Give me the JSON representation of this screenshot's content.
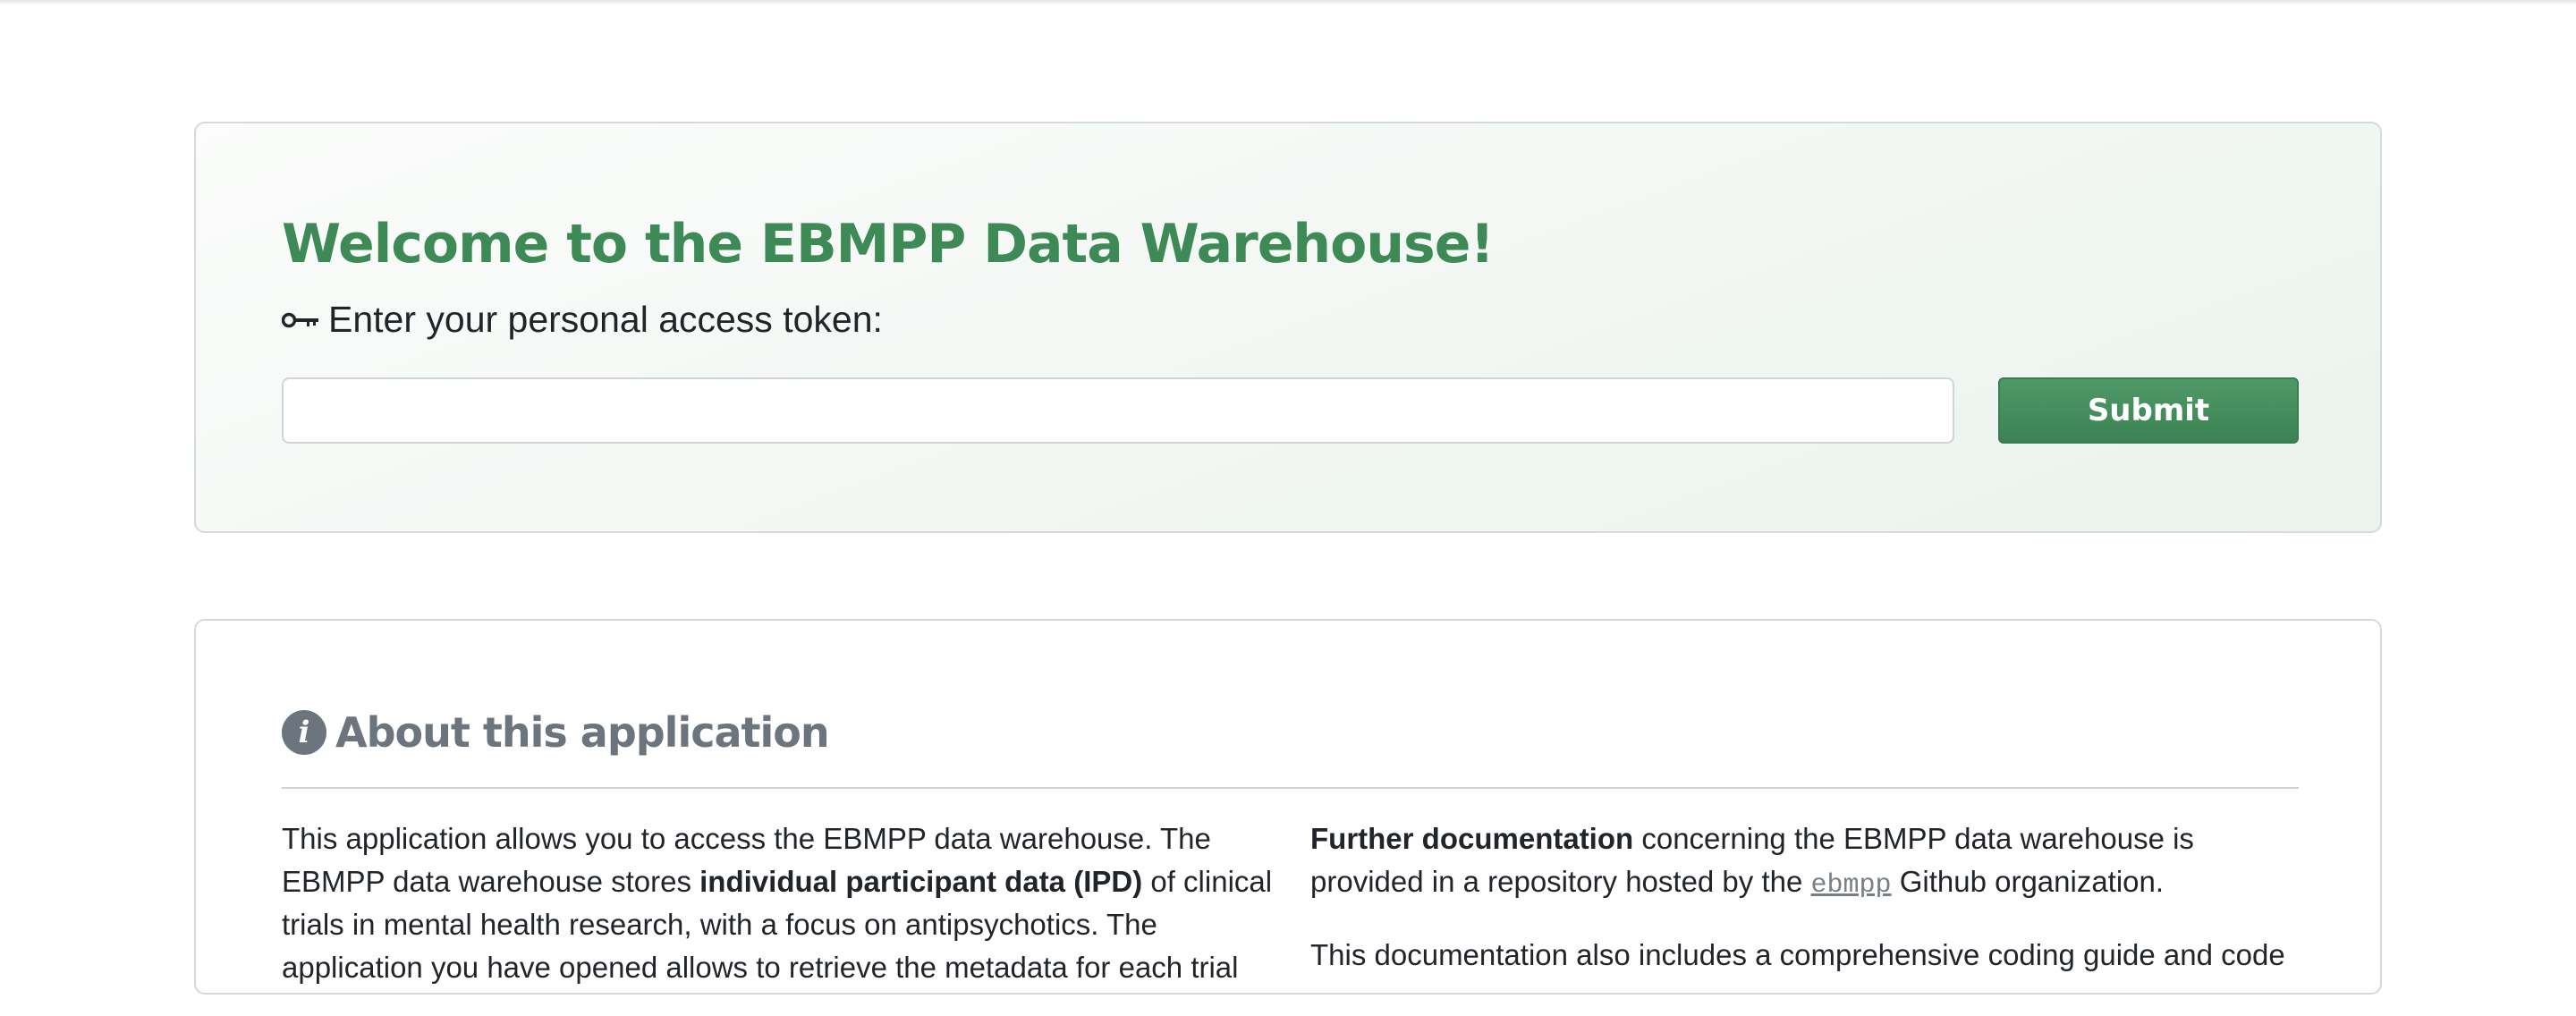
{
  "welcome": {
    "title": "Welcome to the EBMPP Data Warehouse!",
    "token_label": "Enter your personal access token:",
    "token_icon": "key-icon",
    "token_value": "",
    "token_placeholder": "",
    "submit_label": "Submit"
  },
  "about": {
    "icon": "info-icon",
    "icon_glyph": "i",
    "title": "About this application",
    "left": {
      "p1_part1": "This application allows you to access the EBMPP data warehouse. The EBMPP data warehouse stores ",
      "p1_bold": "individual participant data (IPD)",
      "p1_part2": " of clinical trials in mental health research, with a focus on antipsychotics. The application you have opened allows to retrieve the metadata for each trial"
    },
    "right": {
      "p1_bold": "Further documentation",
      "p1_part1": " concerning the EBMPP data warehouse is provided in a repository hosted by the ",
      "p1_link": "ebmpp",
      "p1_part2": " Github organization.",
      "p2": "This documentation also includes a comprehensive coding guide and code"
    }
  },
  "colors": {
    "accent": "#3e8a57",
    "muted": "#6c757d"
  }
}
